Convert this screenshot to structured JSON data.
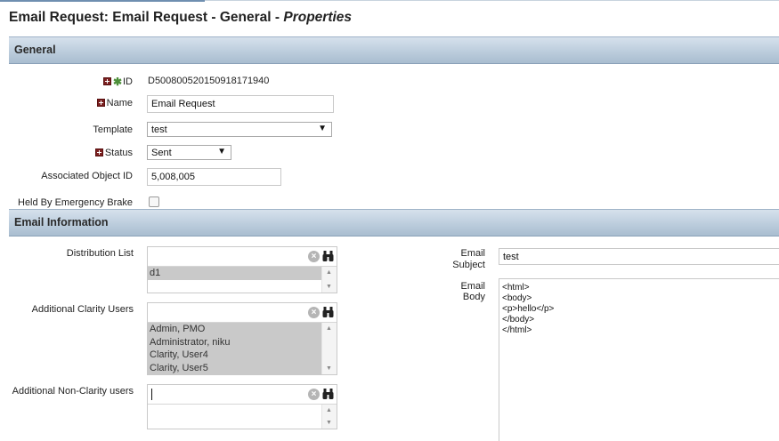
{
  "title": {
    "prefix": "Email Request: Email Request - General - ",
    "suffix": "Properties"
  },
  "sections": {
    "general": "General",
    "email_information": "Email Information"
  },
  "general": {
    "id_label": "ID",
    "id_value": "D50080052015091817194​0",
    "name_label": "Name",
    "name_value": "Email Request",
    "template_label": "Template",
    "template_value": "test",
    "status_label": "Status",
    "status_value": "Sent",
    "assoc_label": "Associated Object ID",
    "assoc_value": "5,008,005",
    "held_label": "Held By Emergency Brake",
    "held_checked": false
  },
  "email": {
    "distribution_label": "Distribution List",
    "distribution_items": [
      "d1"
    ],
    "clarity_users_label": "Additional Clarity Users",
    "clarity_users_items": [
      "Admin, PMO",
      "Administrator, niku",
      "Clarity, User4",
      "Clarity, User5"
    ],
    "non_clarity_label": "Additional Non-Clarity users",
    "non_clarity_items": [],
    "subject_label_1": "Email",
    "subject_label_2": "Subject",
    "subject_value": "test",
    "body_label_1": "Email",
    "body_label_2": "Body",
    "body_value": "<html>\n<body>\n<p>hello</p>\n</body>\n</html>"
  },
  "icons": {
    "required": "required-icon",
    "key": "key-icon",
    "clear": "clear-icon",
    "find": "binoculars-icon"
  },
  "colors": {
    "section_header": "#bccddd",
    "required": "#7a1f1f",
    "key": "#4d8f3a",
    "selected_item": "#c9c9c9"
  }
}
